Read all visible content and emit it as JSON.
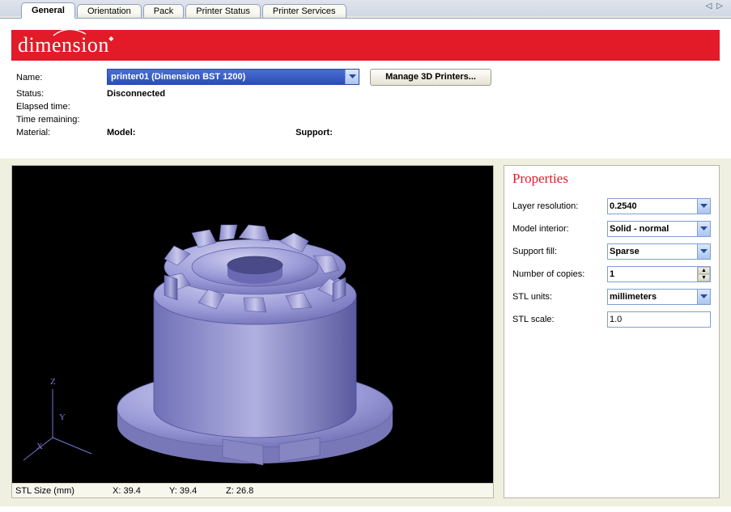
{
  "tabs": {
    "items": [
      "General",
      "Orientation",
      "Pack",
      "Printer Status",
      "Printer Services"
    ],
    "active_index": 0
  },
  "brand": "dimension",
  "info": {
    "name_label": "Name:",
    "name_value": "printer01  (Dimension BST 1200)",
    "manage_button": "Manage 3D Printers...",
    "status_label": "Status:",
    "status_value": "Disconnected",
    "elapsed_label": "Elapsed time:",
    "elapsed_value": "",
    "remaining_label": "Time remaining:",
    "remaining_value": "",
    "material_label": "Material:",
    "model_label": "Model:",
    "support_label": "Support:"
  },
  "viewport": {
    "axes": {
      "x": "X",
      "y": "Y",
      "z": "Z"
    }
  },
  "statusbar": {
    "size_label": "STL Size (mm)",
    "x_label": "X:",
    "x_value": "39.4",
    "y_label": "Y:",
    "y_value": "39.4",
    "z_label": "Z:",
    "z_value": "26.8"
  },
  "properties": {
    "title": "Properties",
    "layer_res_label": "Layer resolution:",
    "layer_res_value": "0.2540",
    "model_int_label": "Model interior:",
    "model_int_value": "Solid - normal",
    "support_fill_label": "Support fill:",
    "support_fill_value": "Sparse",
    "copies_label": "Number of copies:",
    "copies_value": "1",
    "stl_units_label": "STL units:",
    "stl_units_value": "millimeters",
    "stl_scale_label": "STL scale:",
    "stl_scale_value": "1.0"
  }
}
